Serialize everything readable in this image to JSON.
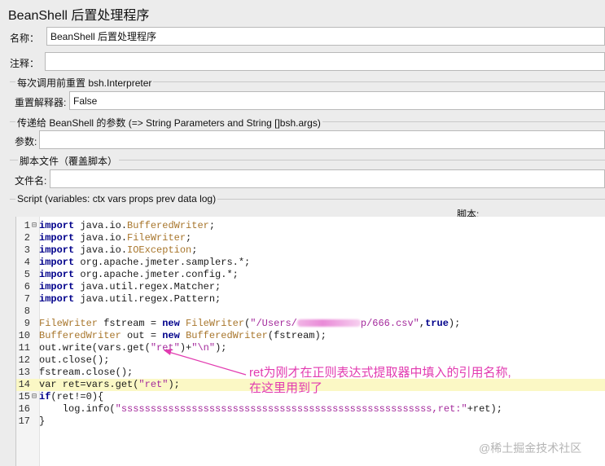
{
  "window": {
    "title": "BeanShell 后置处理程序"
  },
  "form": {
    "name_label": "名称：",
    "name_value": "BeanShell 后置处理程序",
    "comment_label": "注释：",
    "comment_value": "",
    "reset_group_title": "每次调用前重置 bsh.Interpreter",
    "reset_label": "重置解释器:",
    "reset_value": "False",
    "params_group_title": "传递给 BeanShell 的参数 (=> String Parameters and String []bsh.args)",
    "params_label": "参数:",
    "params_value": "",
    "file_group_title": "脚本文件（覆盖脚本）",
    "file_label": "文件名:",
    "file_value": "",
    "script_group_title": "Script (variables: ctx vars props prev data log)",
    "script_label": "脚本:"
  },
  "editor": {
    "highlight_line": 14,
    "fold_lines": [
      1,
      15
    ],
    "lines": [
      [
        [
          "kw",
          "import"
        ],
        [
          "p",
          " java.io."
        ],
        [
          "cls",
          "BufferedWriter"
        ],
        [
          "p",
          ";"
        ]
      ],
      [
        [
          "kw",
          "import"
        ],
        [
          "p",
          " java.io."
        ],
        [
          "cls",
          "FileWriter"
        ],
        [
          "p",
          ";"
        ]
      ],
      [
        [
          "kw",
          "import"
        ],
        [
          "p",
          " java.io."
        ],
        [
          "cls",
          "IOException"
        ],
        [
          "p",
          ";"
        ]
      ],
      [
        [
          "kw",
          "import"
        ],
        [
          "p",
          " org.apache.jmeter.samplers.*;"
        ]
      ],
      [
        [
          "kw",
          "import"
        ],
        [
          "p",
          " org.apache.jmeter.config.*;"
        ]
      ],
      [
        [
          "kw",
          "import"
        ],
        [
          "p",
          " java.util.regex.Matcher;"
        ]
      ],
      [
        [
          "kw",
          "import"
        ],
        [
          "p",
          " java.util.regex.Pattern;"
        ]
      ],
      [],
      [
        [
          "cls",
          "FileWriter"
        ],
        [
          "p",
          " fstream = "
        ],
        [
          "kw",
          "new"
        ],
        [
          "p",
          " "
        ],
        [
          "cls",
          "FileWriter"
        ],
        [
          "p",
          "("
        ],
        [
          "str",
          "\"/Users/"
        ],
        [
          "blur",
          ""
        ],
        [
          "str",
          "p/666.csv\""
        ],
        [
          "p",
          ","
        ],
        [
          "kw",
          "true"
        ],
        [
          "p",
          ");"
        ]
      ],
      [
        [
          "cls",
          "BufferedWriter"
        ],
        [
          "p",
          " out = "
        ],
        [
          "kw",
          "new"
        ],
        [
          "p",
          " "
        ],
        [
          "cls",
          "BufferedWriter"
        ],
        [
          "p",
          "(fstream);"
        ]
      ],
      [
        [
          "p",
          "out.write(vars.get("
        ],
        [
          "str",
          "\"ret\""
        ],
        [
          "p",
          ")+"
        ],
        [
          "str",
          "\"\\n\""
        ],
        [
          "p",
          ");"
        ]
      ],
      [
        [
          "p",
          "out.close();"
        ]
      ],
      [
        [
          "p",
          "fstream.close();"
        ]
      ],
      [
        [
          "p",
          "var ret=vars.get("
        ],
        [
          "str",
          "\"ret\""
        ],
        [
          "p",
          ");"
        ]
      ],
      [
        [
          "kw",
          "if"
        ],
        [
          "p",
          "(ret!=0){"
        ]
      ],
      [
        [
          "p",
          "    log.info("
        ],
        [
          "str",
          "\"sssssssssssssssssssssssssssssssssssssssssssssssssssss,ret:\""
        ],
        [
          "p",
          "+ret);"
        ]
      ],
      [
        [
          "p",
          "}"
        ]
      ]
    ]
  },
  "annotation": {
    "line1": "ret为刚才在正则表达式提取器中填入的引用名称,",
    "line2": "在这里用到了",
    "color": "#e23bb0"
  },
  "watermark": "@稀土掘金技术社区"
}
